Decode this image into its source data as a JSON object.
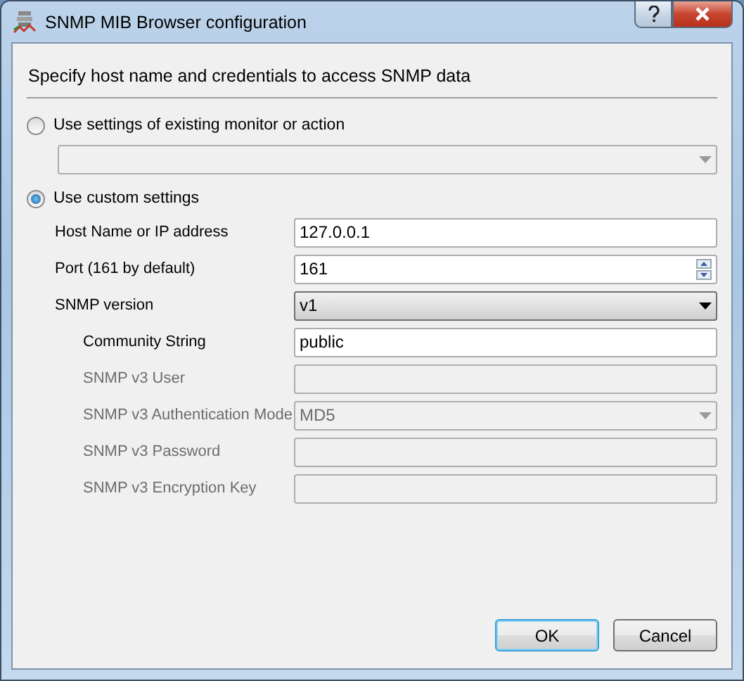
{
  "window": {
    "title": "SNMP MIB Browser configuration"
  },
  "heading": "Specify host name and credentials to access SNMP data",
  "source_options": [
    {
      "label": "Use settings of existing monitor or action",
      "selected": false
    },
    {
      "label": "Use custom settings",
      "selected": true
    }
  ],
  "existing_select": {
    "disabled": true
  },
  "fields": [
    {
      "label": "Host Name or IP address",
      "kind": "text",
      "value": "127.0.0.1",
      "disabled": false
    },
    {
      "label": "Port (161 by default)",
      "kind": "spin",
      "value": "161",
      "disabled": false
    },
    {
      "label": "SNMP version",
      "kind": "select",
      "value": "v1",
      "disabled": false,
      "children": [
        {
          "label": "Community String",
          "kind": "text",
          "value": "public",
          "disabled": false
        },
        {
          "label": "SNMP v3 User",
          "kind": "text",
          "disabled": true
        },
        {
          "label": "SNMP v3 Authentication Mode",
          "kind": "select",
          "value": "MD5",
          "disabled": true
        },
        {
          "label": "SNMP v3 Password",
          "kind": "text",
          "disabled": true
        },
        {
          "label": "SNMP v3 Encryption Key",
          "kind": "text",
          "disabled": true
        }
      ]
    }
  ],
  "buttons": [
    {
      "label": "OK",
      "default": true
    },
    {
      "label": "Cancel",
      "default": false
    }
  ]
}
